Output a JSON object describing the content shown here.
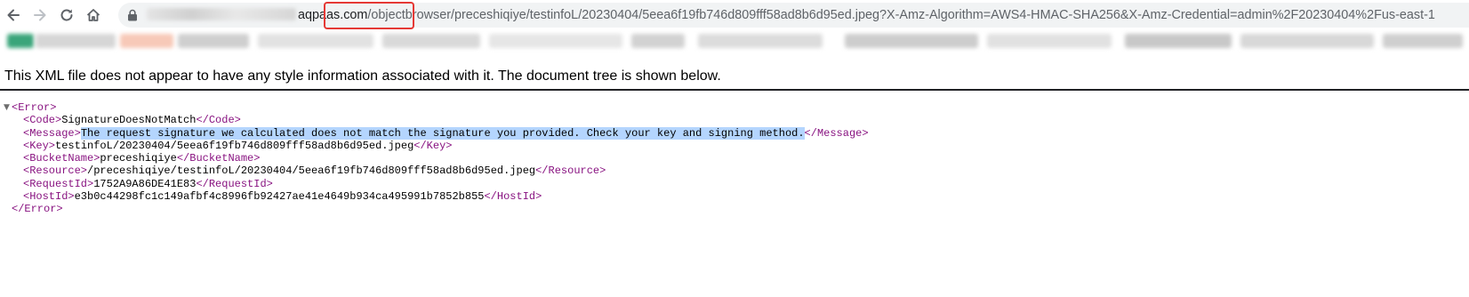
{
  "address_bar": {
    "host": "aqpaas.com",
    "highlighted_segment": "/objectbrowser",
    "path_rest": "/preceshiqiye/testinfoL/20230404/5eea6f19fb746d809fff58ad8b6d95ed.jpeg?X-Amz-Algorithm=AWS4-HMAC-SHA256&X-Amz-Credential=admin%2F20230404%2Fus-east-1"
  },
  "info_banner": "This XML file does not appear to have any style information associated with it. The document tree is shown below.",
  "xml": {
    "root_open": "<Error>",
    "root_close": "</Error>",
    "fields": [
      {
        "open": "<Code>",
        "value": "SignatureDoesNotMatch",
        "close": "</Code>"
      },
      {
        "open": "<Message>",
        "value": "The request signature we calculated does not match the signature you provided. Check your key and signing method.",
        "close": "</Message>"
      },
      {
        "open": "<Key>",
        "value": "testinfoL/20230404/5eea6f19fb746d809fff58ad8b6d95ed.jpeg",
        "close": "</Key>"
      },
      {
        "open": "<BucketName>",
        "value": "preceshiqiye",
        "close": "</BucketName>"
      },
      {
        "open": "<Resource>",
        "value": "/preceshiqiye/testinfoL/20230404/5eea6f19fb746d809fff58ad8b6d95ed.jpeg",
        "close": "</Resource>"
      },
      {
        "open": "<RequestId>",
        "value": "1752A9A86DE41E83",
        "close": "</RequestId>"
      },
      {
        "open": "<HostId>",
        "value": "e3b0c44298fc1c149afbf4c8996fb92427ae41e4649b934ca495991b7852b855",
        "close": "</HostId>"
      }
    ]
  },
  "icons": {
    "back": "back-arrow-icon",
    "forward": "forward-arrow-icon",
    "reload": "reload-icon",
    "home": "home-icon",
    "lock": "lock-icon",
    "toggle": "collapse-triangle-icon"
  },
  "colors": {
    "tag": "#881280",
    "selection": "#b4d5fe",
    "highlight_box": "#e53935"
  }
}
